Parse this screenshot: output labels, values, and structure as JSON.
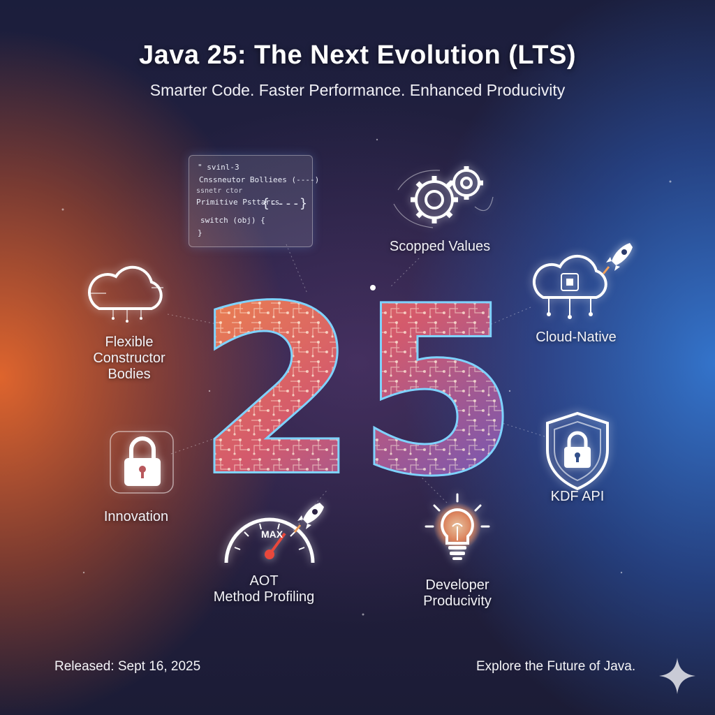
{
  "header": {
    "title": "Java 25: The Next Evolution (LTS)",
    "subtitle": "Smarter Code. Faster Performance. Enhanced Producivity"
  },
  "hero": {
    "number": "25"
  },
  "code_card": {
    "lines": [
      "\" svinl-3",
      "Cnssneutor  Bolliees  (----)",
      "ssnetr ctor",
      "Primitive Psttarrs",
      "{----}",
      "switch (obj) {",
      "}"
    ]
  },
  "features": {
    "flexible_constructor": "Flexible\nConstructor\nBodies",
    "innovation": "Innovation",
    "aot": "AOT\nMethod Profiling",
    "scoped_values": "Scopped Values",
    "cloud_native": "Cloud-Native",
    "kdf_api": "KDF API",
    "developer_productivity": "Developer\nProducivity"
  },
  "gauge": {
    "label": "MAX"
  },
  "footer": {
    "released": "Released: Sept 16, 2025",
    "explore": "Explore the Future of Java."
  },
  "colors": {
    "accent_orange": "#e8682c",
    "accent_blue": "#3478d2",
    "numeral_outline": "#7fd3ff",
    "gauge_needle": "#e8483c"
  },
  "icons": [
    "cloud-circuit-icon",
    "padlock-circuit-icon",
    "speedometer-icon",
    "rocket-icon",
    "gears-icon",
    "cloud-chip-icon",
    "shield-lock-icon",
    "lightbulb-icon",
    "sparkle-icon"
  ]
}
